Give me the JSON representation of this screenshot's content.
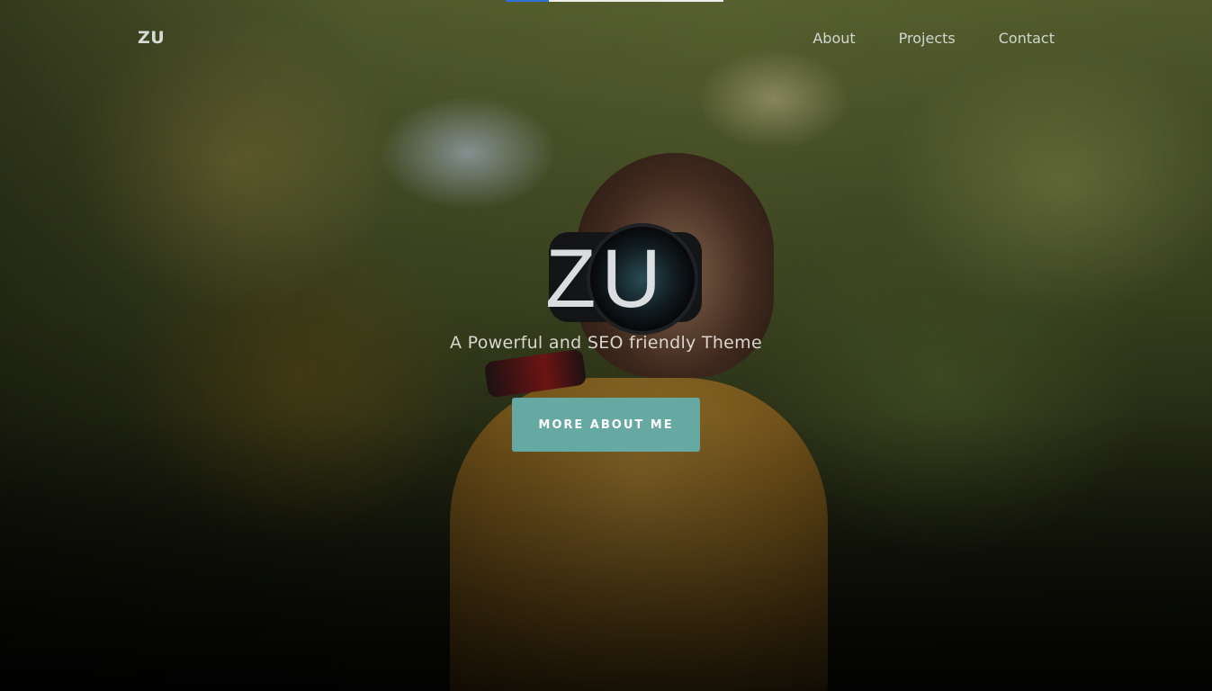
{
  "navbar": {
    "brand": "ZU",
    "links": [
      {
        "label": "About"
      },
      {
        "label": "Projects"
      },
      {
        "label": "Contact"
      }
    ]
  },
  "hero": {
    "title": "ZU",
    "subtitle": "A Powerful and SEO friendly Theme",
    "cta_label": "MORE ABOUT ME",
    "background_image": "photographer-with-camera-in-forest"
  },
  "loading_bar": {
    "progress_fraction": 0.2
  },
  "colors": {
    "accent": "#66a8a2",
    "nav_text": "#d3d6d0",
    "progress": "#2f6fd6"
  }
}
